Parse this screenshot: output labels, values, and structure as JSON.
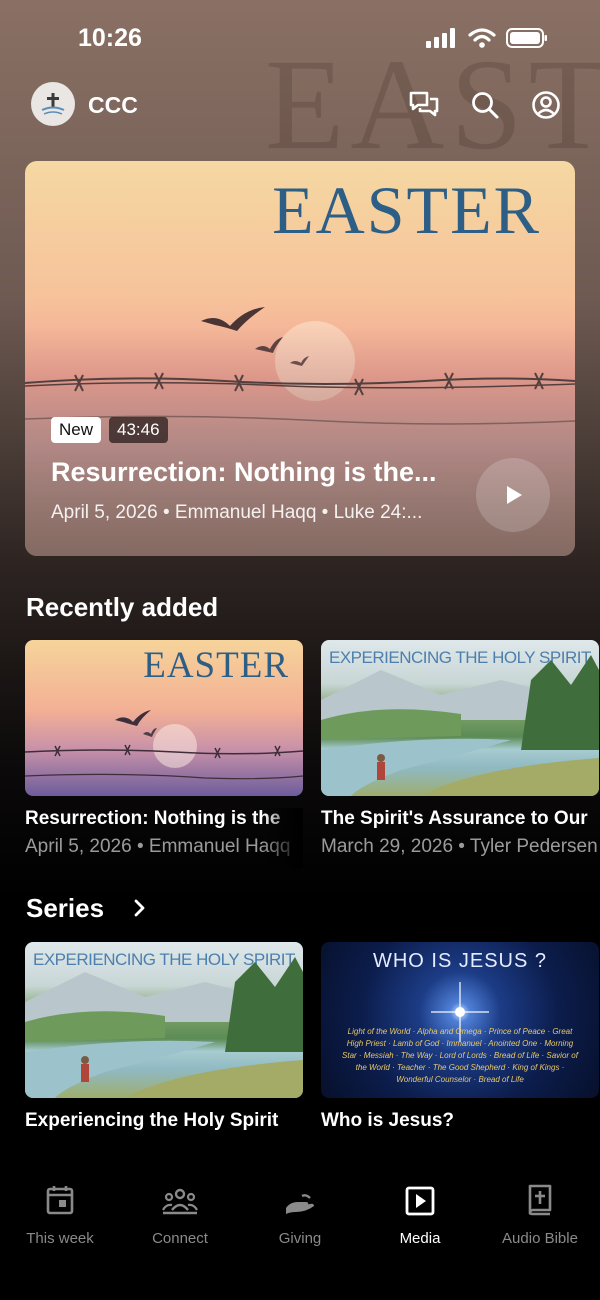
{
  "status_bar": {
    "time": "10:26"
  },
  "header": {
    "brand": "CCC"
  },
  "hero": {
    "art_title": "EASTER",
    "badge_new": "New",
    "duration": "43:46",
    "title": "Resurrection: Nothing is the...",
    "meta": "April 5, 2026 • Emmanuel Haqq • Luke 24:..."
  },
  "recently_added": {
    "heading": "Recently added",
    "items": [
      {
        "art_title": "EASTER",
        "title": "Resurrection: Nothing is the",
        "meta": "April 5, 2026 • Emmanuel Haqq"
      },
      {
        "art_title": "EXPERIENCING THE HOLY SPIRIT",
        "title": "The Spirit's Assurance to Our",
        "meta": "March 29, 2026 • Tyler Pedersen"
      }
    ]
  },
  "series": {
    "heading": "Series",
    "items": [
      {
        "art_title": "EXPERIENCING THE HOLY SPIRIT",
        "title": "Experiencing the Holy Spirit"
      },
      {
        "art_title": "WHO IS JESUS ?",
        "title": "Who is Jesus?",
        "art_names": "Light of the World · Alpha and Omega · Prince of Peace · Great High Priest · Lamb of God · Immanuel · Anointed One · Morning Star · Messiah · The Way · Lord of Lords · Bread of Life · Savior of the World · Teacher · The Good Shepherd · King of Kings · Wonderful Counselor · Bread of Life"
      }
    ]
  },
  "nav": {
    "items": [
      {
        "label": "This week",
        "icon": "calendar-icon"
      },
      {
        "label": "Connect",
        "icon": "people-icon"
      },
      {
        "label": "Giving",
        "icon": "giving-hand-icon"
      },
      {
        "label": "Media",
        "icon": "play-square-icon",
        "active": true
      },
      {
        "label": "Audio Bible",
        "icon": "bible-icon"
      }
    ]
  },
  "colors": {
    "accent_art_title": "#2d5e86",
    "nav_inactive": "#8a8a8a",
    "nav_active": "#ffffff"
  }
}
